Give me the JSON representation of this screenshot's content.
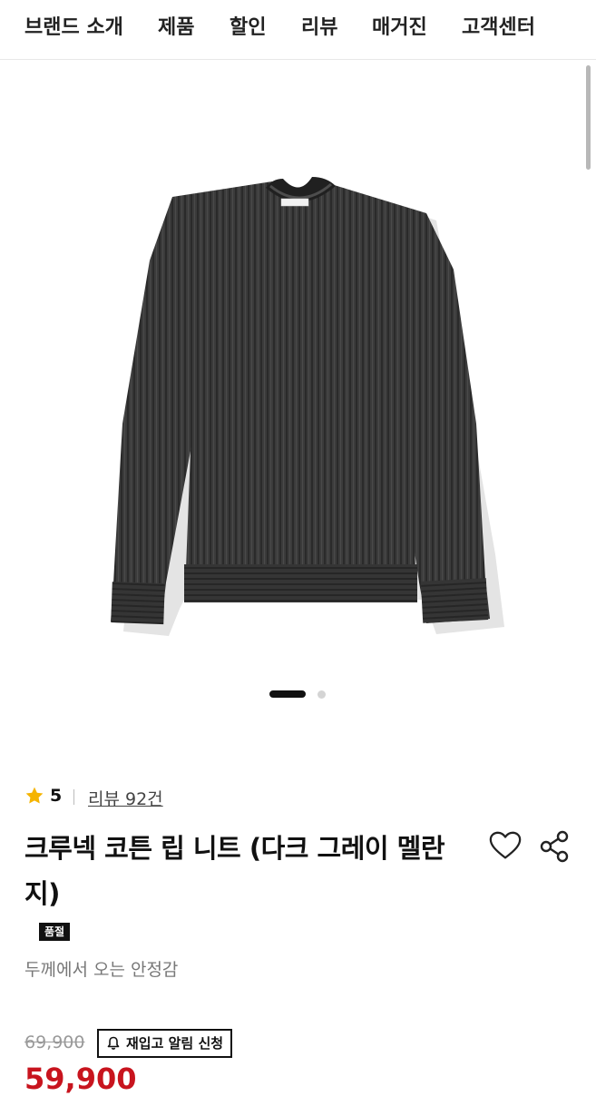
{
  "nav": {
    "items": [
      "브랜드 소개",
      "제품",
      "할인",
      "리뷰",
      "매거진",
      "고객센터"
    ]
  },
  "gallery": {
    "image": "sweater-image",
    "slide_current": 1,
    "slide_total": 2
  },
  "product": {
    "rating": "5",
    "review_link": "리뷰 92건",
    "title": "크루넥 코튼 립 니트 (다크 그레이 멜란지)",
    "badge": "품절",
    "subtitle": "두께에서 오는 안정감",
    "original_price": "69,900",
    "restock_button": "재입고 알림 신청",
    "sale_price": "59,900"
  },
  "icons": {
    "star": "star-icon",
    "heart": "heart-icon",
    "share": "share-icon",
    "bell": "bell-icon"
  },
  "colors": {
    "sale_price": "#c8141e",
    "star": "#f5b400",
    "sweater": "#3a3a3a"
  }
}
